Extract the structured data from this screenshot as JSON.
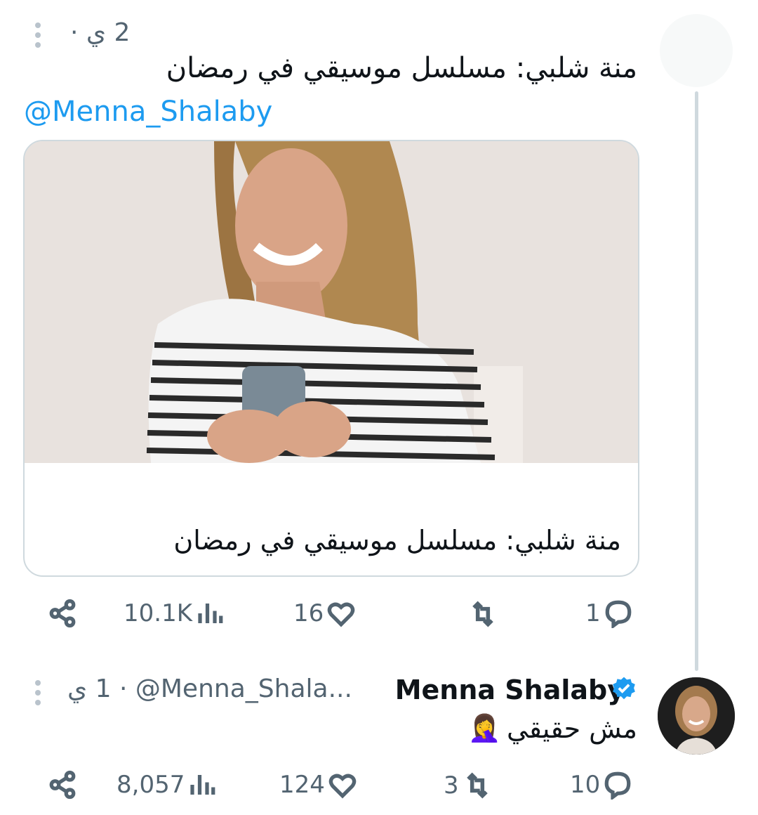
{
  "tweet1": {
    "time": "2 ي ·",
    "text": "منة شلبي: مسلسل موسيقي في رمضان",
    "mention": "@Menna_Shalaby",
    "card_title": "منة شلبي: مسلسل موسيقي في رمضان",
    "actions": {
      "replies": "1",
      "retweets": "",
      "likes": "16",
      "views": "10.1K"
    }
  },
  "tweet2": {
    "name": "Menna Shalaby",
    "handle": "@Menna_Shala...",
    "time": "· 1 ي",
    "text": "مش حقيقي",
    "emoji": "🤦‍♀️",
    "actions": {
      "replies": "10",
      "retweets": "3",
      "likes": "124",
      "views": "8,057"
    }
  },
  "icons": [
    "more-icon",
    "reply-icon",
    "retweet-icon",
    "like-icon",
    "views-icon",
    "share-icon",
    "verified-icon"
  ],
  "colors": {
    "link": "#1d9bf0",
    "muted": "#536471",
    "verified": "#1d9bf0"
  }
}
